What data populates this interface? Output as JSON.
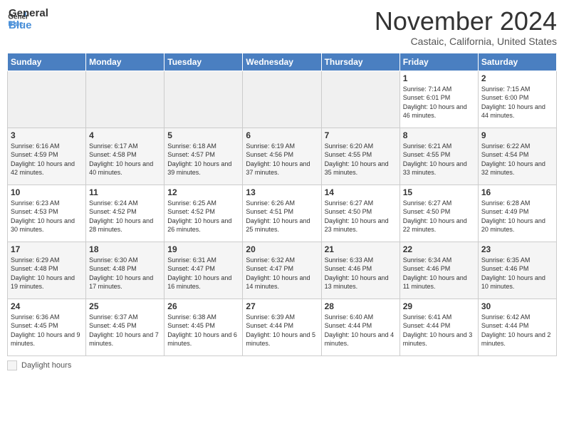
{
  "header": {
    "logo_line1": "General",
    "logo_line2": "Blue",
    "month_title": "November 2024",
    "subtitle": "Castaic, California, United States"
  },
  "days_of_week": [
    "Sunday",
    "Monday",
    "Tuesday",
    "Wednesday",
    "Thursday",
    "Friday",
    "Saturday"
  ],
  "weeks": [
    [
      {
        "num": "",
        "info": ""
      },
      {
        "num": "",
        "info": ""
      },
      {
        "num": "",
        "info": ""
      },
      {
        "num": "",
        "info": ""
      },
      {
        "num": "",
        "info": ""
      },
      {
        "num": "1",
        "info": "Sunrise: 7:14 AM\nSunset: 6:01 PM\nDaylight: 10 hours and 46 minutes."
      },
      {
        "num": "2",
        "info": "Sunrise: 7:15 AM\nSunset: 6:00 PM\nDaylight: 10 hours and 44 minutes."
      }
    ],
    [
      {
        "num": "3",
        "info": "Sunrise: 6:16 AM\nSunset: 4:59 PM\nDaylight: 10 hours and 42 minutes."
      },
      {
        "num": "4",
        "info": "Sunrise: 6:17 AM\nSunset: 4:58 PM\nDaylight: 10 hours and 40 minutes."
      },
      {
        "num": "5",
        "info": "Sunrise: 6:18 AM\nSunset: 4:57 PM\nDaylight: 10 hours and 39 minutes."
      },
      {
        "num": "6",
        "info": "Sunrise: 6:19 AM\nSunset: 4:56 PM\nDaylight: 10 hours and 37 minutes."
      },
      {
        "num": "7",
        "info": "Sunrise: 6:20 AM\nSunset: 4:55 PM\nDaylight: 10 hours and 35 minutes."
      },
      {
        "num": "8",
        "info": "Sunrise: 6:21 AM\nSunset: 4:55 PM\nDaylight: 10 hours and 33 minutes."
      },
      {
        "num": "9",
        "info": "Sunrise: 6:22 AM\nSunset: 4:54 PM\nDaylight: 10 hours and 32 minutes."
      }
    ],
    [
      {
        "num": "10",
        "info": "Sunrise: 6:23 AM\nSunset: 4:53 PM\nDaylight: 10 hours and 30 minutes."
      },
      {
        "num": "11",
        "info": "Sunrise: 6:24 AM\nSunset: 4:52 PM\nDaylight: 10 hours and 28 minutes."
      },
      {
        "num": "12",
        "info": "Sunrise: 6:25 AM\nSunset: 4:52 PM\nDaylight: 10 hours and 26 minutes."
      },
      {
        "num": "13",
        "info": "Sunrise: 6:26 AM\nSunset: 4:51 PM\nDaylight: 10 hours and 25 minutes."
      },
      {
        "num": "14",
        "info": "Sunrise: 6:27 AM\nSunset: 4:50 PM\nDaylight: 10 hours and 23 minutes."
      },
      {
        "num": "15",
        "info": "Sunrise: 6:27 AM\nSunset: 4:50 PM\nDaylight: 10 hours and 22 minutes."
      },
      {
        "num": "16",
        "info": "Sunrise: 6:28 AM\nSunset: 4:49 PM\nDaylight: 10 hours and 20 minutes."
      }
    ],
    [
      {
        "num": "17",
        "info": "Sunrise: 6:29 AM\nSunset: 4:48 PM\nDaylight: 10 hours and 19 minutes."
      },
      {
        "num": "18",
        "info": "Sunrise: 6:30 AM\nSunset: 4:48 PM\nDaylight: 10 hours and 17 minutes."
      },
      {
        "num": "19",
        "info": "Sunrise: 6:31 AM\nSunset: 4:47 PM\nDaylight: 10 hours and 16 minutes."
      },
      {
        "num": "20",
        "info": "Sunrise: 6:32 AM\nSunset: 4:47 PM\nDaylight: 10 hours and 14 minutes."
      },
      {
        "num": "21",
        "info": "Sunrise: 6:33 AM\nSunset: 4:46 PM\nDaylight: 10 hours and 13 minutes."
      },
      {
        "num": "22",
        "info": "Sunrise: 6:34 AM\nSunset: 4:46 PM\nDaylight: 10 hours and 11 minutes."
      },
      {
        "num": "23",
        "info": "Sunrise: 6:35 AM\nSunset: 4:46 PM\nDaylight: 10 hours and 10 minutes."
      }
    ],
    [
      {
        "num": "24",
        "info": "Sunrise: 6:36 AM\nSunset: 4:45 PM\nDaylight: 10 hours and 9 minutes."
      },
      {
        "num": "25",
        "info": "Sunrise: 6:37 AM\nSunset: 4:45 PM\nDaylight: 10 hours and 7 minutes."
      },
      {
        "num": "26",
        "info": "Sunrise: 6:38 AM\nSunset: 4:45 PM\nDaylight: 10 hours and 6 minutes."
      },
      {
        "num": "27",
        "info": "Sunrise: 6:39 AM\nSunset: 4:44 PM\nDaylight: 10 hours and 5 minutes."
      },
      {
        "num": "28",
        "info": "Sunrise: 6:40 AM\nSunset: 4:44 PM\nDaylight: 10 hours and 4 minutes."
      },
      {
        "num": "29",
        "info": "Sunrise: 6:41 AM\nSunset: 4:44 PM\nDaylight: 10 hours and 3 minutes."
      },
      {
        "num": "30",
        "info": "Sunrise: 6:42 AM\nSunset: 4:44 PM\nDaylight: 10 hours and 2 minutes."
      }
    ]
  ],
  "footer": {
    "legend_label": "Daylight hours"
  }
}
